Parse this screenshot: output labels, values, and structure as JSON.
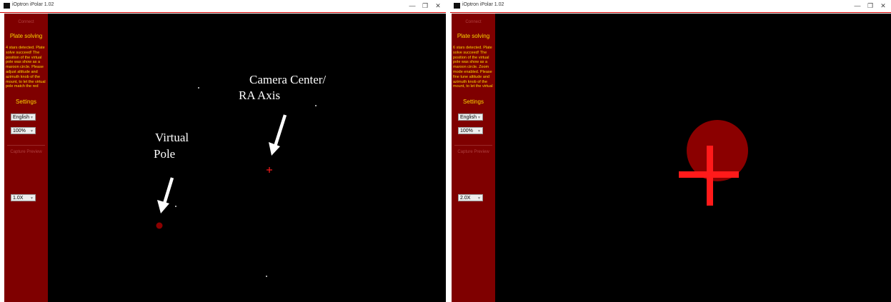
{
  "windows": [
    {
      "title": "iOptron iPolar 1.02",
      "sidebar": {
        "connect_label": "Connect",
        "plate_solving_heading": "Plate solving",
        "status_message": "4 stars detected. Plate solve succeed! The position of the virtual pole was show as a maroon circle. Please adjust altitude and azimuth knob of the mount, to let the virtual pole match the red",
        "settings_heading": "Settings",
        "language_value": "English",
        "zoom_percent_value": "100%",
        "capture_label": "Capture Preview",
        "magnification_value": "1.0X"
      },
      "annotations": {
        "camera_center": "Camera Center/",
        "ra_axis": "RA Axis",
        "virtual": "Virtual",
        "pole": "Pole"
      }
    },
    {
      "title": "iOptron iPolar 1.02",
      "sidebar": {
        "connect_label": "Connect",
        "plate_solving_heading": "Plate solving",
        "status_message": "6 stars detected. Plate solve succeed! The position of the virtual pole was show as a maroon circle. Zoom mode enabled. Please fine tune altitude and azimuth knob of the mount, to let the virtual",
        "settings_heading": "Settings",
        "language_value": "English",
        "zoom_percent_value": "100%",
        "capture_label": "Capture Preview",
        "magnification_value": "2.0X"
      }
    }
  ],
  "window_controls": {
    "minimize": "—",
    "restore": "❐",
    "close": "✕"
  },
  "colors": {
    "sidebar_bg": "#7f0000",
    "sidebar_text": "#ffd800",
    "virtual_pole": "#8b0000",
    "crosshair": "#ff1a1a",
    "view_bg": "#000000"
  }
}
